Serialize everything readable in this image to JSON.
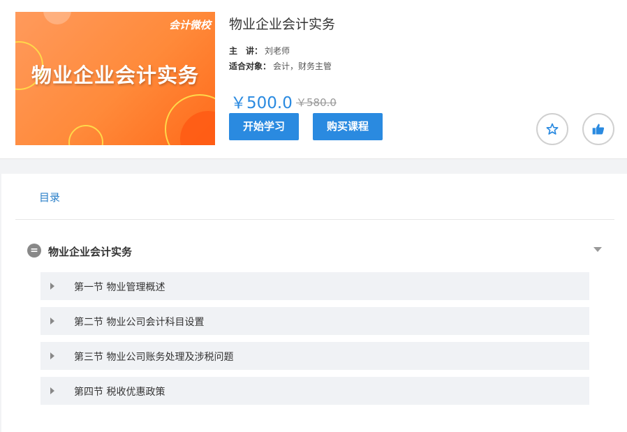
{
  "course": {
    "cover_logo": "会计微校",
    "cover_title": "物业企业会计实务",
    "title": "物业企业会计实务",
    "lecturer_label": "主　讲：",
    "lecturer": "刘老师",
    "audience_label": "适合对象：",
    "audience": "会计，财务主管",
    "price": "￥500.0",
    "original_price": "￥580.0",
    "start_label": "开始学习",
    "buy_label": "购买课程"
  },
  "colors": {
    "accent": "#2a8ae0",
    "cover": "#ff8a3a"
  },
  "icons": {
    "favorite": "star-outline-icon",
    "like": "thumbs-up-icon"
  },
  "toc": {
    "tab_label": "目录",
    "chapter": {
      "icon": "=",
      "title": "物业企业会计实务",
      "sections": [
        "第一节 物业管理概述",
        "第二节 物业公司会计科目设置",
        "第三节 物业公司账务处理及涉税问题",
        "第四节 税收优惠政策"
      ]
    }
  }
}
